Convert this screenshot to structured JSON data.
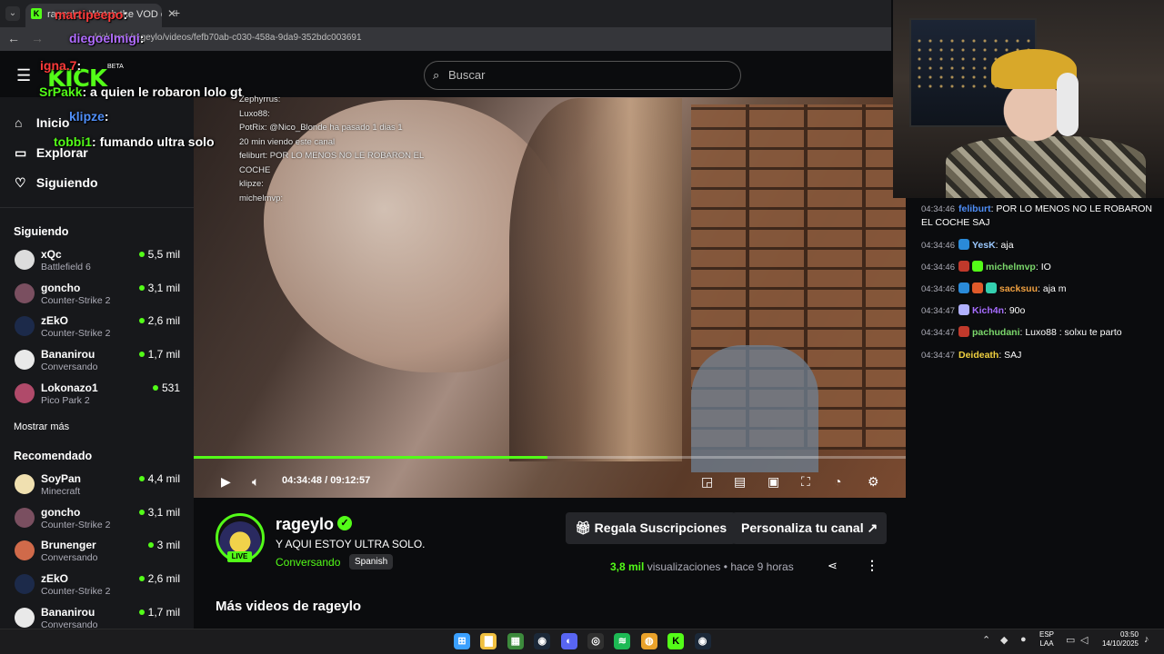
{
  "browser": {
    "tab_title": "rageylo - Watch the VOD on Kick",
    "tab_close": "✕",
    "new_tab": "+",
    "url": "kick.com/rageylo/videos/fefb70ab-c030-458a-9da9-352bdc003691"
  },
  "header": {
    "logo": "KICK",
    "beta": "BETA",
    "search_placeholder": "Buscar"
  },
  "sidebar": {
    "nav": [
      {
        "label": "Inicio",
        "icon": "home-icon"
      },
      {
        "label": "Explorar",
        "icon": "browse-icon"
      },
      {
        "label": "Siguiendo",
        "icon": "heart-icon"
      }
    ],
    "following_title": "Siguiendo",
    "following": [
      {
        "name": "xQc",
        "category": "Battlefield 6",
        "viewers": "5,5 mil",
        "avatar_color": "#dcdcdc"
      },
      {
        "name": "goncho",
        "category": "Counter-Strike 2",
        "viewers": "3,1 mil",
        "avatar_color": "#7a4f60"
      },
      {
        "name": "zEkO",
        "category": "Counter-Strike 2",
        "viewers": "2,6 mil",
        "avatar_color": "#1c2a4a"
      },
      {
        "name": "Bananirou",
        "category": "Conversando",
        "viewers": "1,7 mil",
        "avatar_color": "#e9e9e9"
      },
      {
        "name": "Lokonazo1",
        "category": "Pico Park 2",
        "viewers": "531",
        "avatar_color": "#b04a6a"
      }
    ],
    "show_more": "Mostrar más",
    "recommended_title": "Recomendado",
    "recommended": [
      {
        "name": "SoyPan",
        "category": "Minecraft",
        "viewers": "4,4 mil",
        "avatar_color": "#f0e0b0"
      },
      {
        "name": "goncho",
        "category": "Counter-Strike 2",
        "viewers": "3,1 mil",
        "avatar_color": "#7a4f60"
      },
      {
        "name": "Brunenger",
        "category": "Conversando",
        "viewers": "3 mil",
        "avatar_color": "#d06a4a"
      },
      {
        "name": "zEkO",
        "category": "Counter-Strike 2",
        "viewers": "2,6 mil",
        "avatar_color": "#1c2a4a"
      },
      {
        "name": "Bananirou",
        "category": "Conversando",
        "viewers": "1,7 mil",
        "avatar_color": "#e9e9e9"
      }
    ]
  },
  "video": {
    "progress_fraction": 0.497,
    "time_current": "04:34:48",
    "time_separator": "/",
    "time_total": "09:12:57",
    "embedded_chat": [
      "Zephyrrus:",
      "Luxo88:",
      "PotRix: @Nico_Blonde ha pasado 1 dias 1",
      "20 min viendo este canal",
      "feliburt: POR LO MENOS NO LE ROBARON EL",
      "COCHE",
      "klipze:",
      "michelmvp:"
    ]
  },
  "stream": {
    "streamer": "rageylo",
    "live": "LIVE",
    "title": "Y AQUI ESTOY ULTRA SOLO.",
    "category": "Conversando",
    "language": "Spanish",
    "gift_button": "Regala Suscripciones",
    "customize_button": "Personaliza tu canal",
    "views_count": "3,8 mil",
    "views_label": "visualizaciones",
    "dot": "•",
    "ago": "hace 9 horas",
    "more_videos": "Más videos de rageylo"
  },
  "chat": [
    {
      "ts": "04:34:46",
      "user": "feliburt",
      "color": "#4f8ef7",
      "text": "POR LO MENOS NO LE ROBARON EL COCHE SAJ",
      "badges": []
    },
    {
      "ts": "04:34:46",
      "user": "YesK",
      "color": "#9ac8ff",
      "text": "aja",
      "badges": [
        "#2a8ad8"
      ]
    },
    {
      "ts": "04:34:46",
      "user": "michelmvp",
      "color": "#7bd86b",
      "text": "IO",
      "badges": [
        "#c0392b",
        "#53fc18"
      ]
    },
    {
      "ts": "04:34:46",
      "user": "sacksuu",
      "color": "#f0a040",
      "text": "aja m",
      "badges": [
        "#2a8ad8",
        "#e05a2a",
        "#34d0b0"
      ]
    },
    {
      "ts": "04:34:47",
      "user": "Kich4n",
      "color": "#a66cff",
      "text": "90o",
      "badges": [
        "#b0b0ff"
      ]
    },
    {
      "ts": "04:34:47",
      "user": "pachudani",
      "color": "#7bd86b",
      "text": "Luxo88 : solxu te parto",
      "badges": [
        "#c0392b"
      ]
    },
    {
      "ts": "04:34:47",
      "user": "Deideath",
      "color": "#f0d040",
      "text": "SAJ",
      "badges": []
    }
  ],
  "overlay_chat": [
    {
      "user": "martipeepo",
      "text": "",
      "color": "#ff3a3a"
    },
    {
      "user": "diegoelmigi",
      "text": "",
      "color": "#b06cff"
    },
    {
      "user": "igna.7",
      "text": "",
      "color": "#ff3a3a"
    },
    {
      "user": "SrPakk",
      "text": "a quien le robaron lolo gt",
      "color": "#53fc18"
    },
    {
      "user": "klipze",
      "text": "",
      "color": "#4f8ef7"
    },
    {
      "user": "tobbi1",
      "text": "fumando ultra solo",
      "color": "#53fc18"
    }
  ],
  "taskbar": {
    "lang_1": "ESP",
    "lang_2": "LAA",
    "time": "03:50",
    "date": "14/10/2025",
    "apps": [
      {
        "name": "windows-start",
        "color": "#3aa0ff",
        "glyph": "⊞"
      },
      {
        "name": "file-explorer",
        "color": "#f0c040",
        "glyph": "▇"
      },
      {
        "name": "app-green",
        "color": "#3c8a3c",
        "glyph": "▦"
      },
      {
        "name": "steam",
        "color": "#1b2838",
        "glyph": "◉"
      },
      {
        "name": "discord",
        "color": "#5865f2",
        "glyph": "◐"
      },
      {
        "name": "obs",
        "color": "#303030",
        "glyph": "◎"
      },
      {
        "name": "spotify",
        "color": "#1db954",
        "glyph": "≋"
      },
      {
        "name": "chrome",
        "color": "#e9a22a",
        "glyph": "◍"
      },
      {
        "name": "kick",
        "color": "#53fc18",
        "glyph": "K"
      },
      {
        "name": "steam-2",
        "color": "#1b2838",
        "glyph": "◉"
      }
    ]
  }
}
